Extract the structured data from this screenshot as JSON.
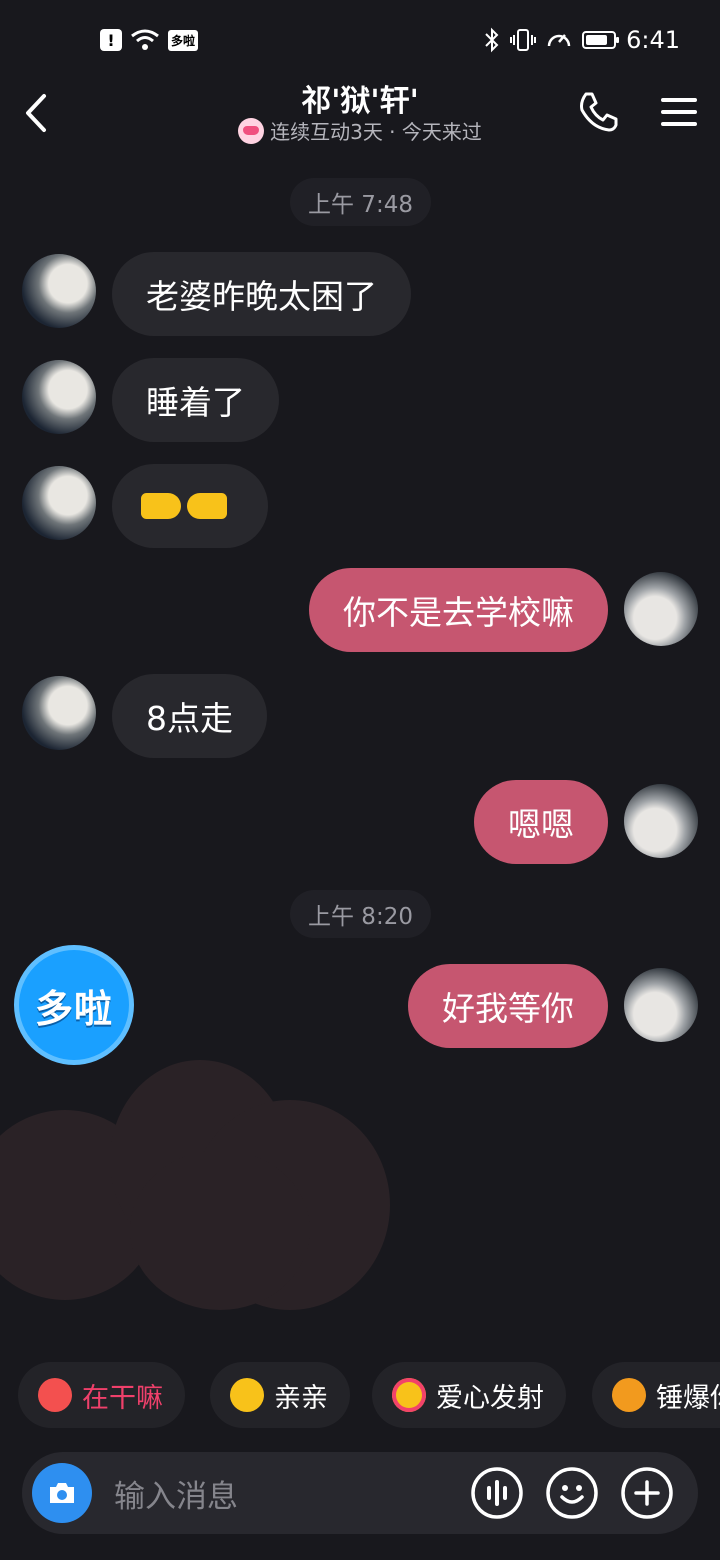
{
  "status_bar": {
    "app_badge": "多啦",
    "time": "6:41"
  },
  "header": {
    "title": "祁'狱'轩'",
    "subtitle": "连续互动3天 · 今天来过"
  },
  "messages": [
    {
      "type": "time",
      "text": "上午 7:48"
    },
    {
      "type": "in",
      "text": "老婆昨晚太困了"
    },
    {
      "type": "in",
      "text": "睡着了"
    },
    {
      "type": "in",
      "emoji": "pointing-hands"
    },
    {
      "type": "out",
      "text": "你不是去学校嘛"
    },
    {
      "type": "in",
      "text": "8点走"
    },
    {
      "type": "out",
      "text": "嗯嗯"
    },
    {
      "type": "time",
      "text": "上午 8:20"
    },
    {
      "type": "out",
      "text": "好我等你"
    }
  ],
  "floating_button": {
    "label": "多啦"
  },
  "quick_replies": [
    {
      "label": "在干嘛",
      "color": "#f0406b",
      "icon": "camera-bear-icon"
    },
    {
      "label": "亲亲",
      "color": "#ffffff",
      "icon": "kiss-emoji-icon"
    },
    {
      "label": "爱心发射",
      "color": "#ffffff",
      "icon": "heart-eyes-emoji-icon"
    },
    {
      "label": "锤爆你",
      "color": "#ffffff",
      "icon": "hammer-emoji-icon"
    }
  ],
  "input": {
    "placeholder": "输入消息"
  },
  "colors": {
    "background": "#18181d",
    "incoming_bubble": "#28282d",
    "outgoing_bubble": "#c65670",
    "accent_blue": "#2e8ff0"
  }
}
